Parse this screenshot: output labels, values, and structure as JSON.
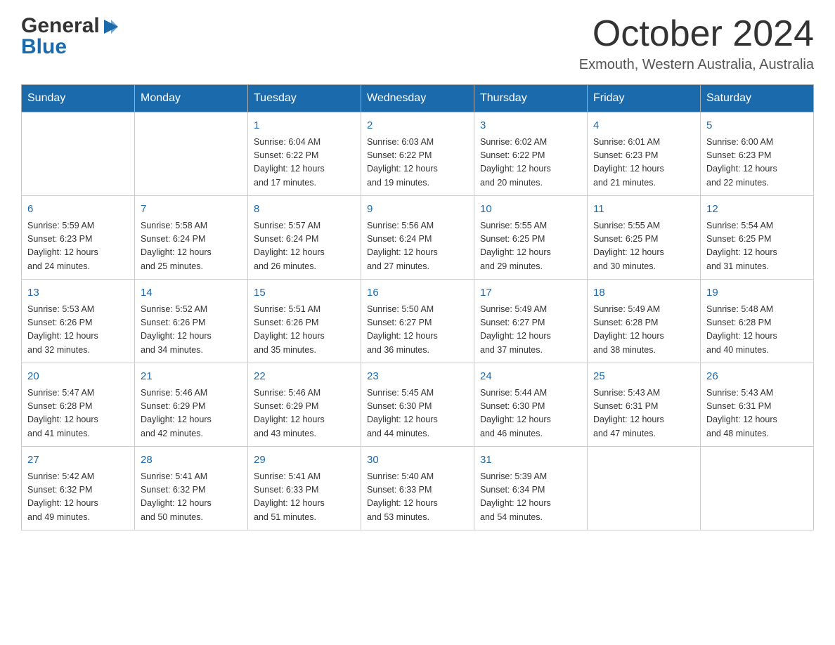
{
  "header": {
    "logo_general": "General",
    "logo_blue": "Blue",
    "month_title": "October 2024",
    "location": "Exmouth, Western Australia, Australia"
  },
  "weekdays": [
    "Sunday",
    "Monday",
    "Tuesday",
    "Wednesday",
    "Thursday",
    "Friday",
    "Saturday"
  ],
  "weeks": [
    [
      {
        "day": "",
        "info": ""
      },
      {
        "day": "",
        "info": ""
      },
      {
        "day": "1",
        "info": "Sunrise: 6:04 AM\nSunset: 6:22 PM\nDaylight: 12 hours\nand 17 minutes."
      },
      {
        "day": "2",
        "info": "Sunrise: 6:03 AM\nSunset: 6:22 PM\nDaylight: 12 hours\nand 19 minutes."
      },
      {
        "day": "3",
        "info": "Sunrise: 6:02 AM\nSunset: 6:22 PM\nDaylight: 12 hours\nand 20 minutes."
      },
      {
        "day": "4",
        "info": "Sunrise: 6:01 AM\nSunset: 6:23 PM\nDaylight: 12 hours\nand 21 minutes."
      },
      {
        "day": "5",
        "info": "Sunrise: 6:00 AM\nSunset: 6:23 PM\nDaylight: 12 hours\nand 22 minutes."
      }
    ],
    [
      {
        "day": "6",
        "info": "Sunrise: 5:59 AM\nSunset: 6:23 PM\nDaylight: 12 hours\nand 24 minutes."
      },
      {
        "day": "7",
        "info": "Sunrise: 5:58 AM\nSunset: 6:24 PM\nDaylight: 12 hours\nand 25 minutes."
      },
      {
        "day": "8",
        "info": "Sunrise: 5:57 AM\nSunset: 6:24 PM\nDaylight: 12 hours\nand 26 minutes."
      },
      {
        "day": "9",
        "info": "Sunrise: 5:56 AM\nSunset: 6:24 PM\nDaylight: 12 hours\nand 27 minutes."
      },
      {
        "day": "10",
        "info": "Sunrise: 5:55 AM\nSunset: 6:25 PM\nDaylight: 12 hours\nand 29 minutes."
      },
      {
        "day": "11",
        "info": "Sunrise: 5:55 AM\nSunset: 6:25 PM\nDaylight: 12 hours\nand 30 minutes."
      },
      {
        "day": "12",
        "info": "Sunrise: 5:54 AM\nSunset: 6:25 PM\nDaylight: 12 hours\nand 31 minutes."
      }
    ],
    [
      {
        "day": "13",
        "info": "Sunrise: 5:53 AM\nSunset: 6:26 PM\nDaylight: 12 hours\nand 32 minutes."
      },
      {
        "day": "14",
        "info": "Sunrise: 5:52 AM\nSunset: 6:26 PM\nDaylight: 12 hours\nand 34 minutes."
      },
      {
        "day": "15",
        "info": "Sunrise: 5:51 AM\nSunset: 6:26 PM\nDaylight: 12 hours\nand 35 minutes."
      },
      {
        "day": "16",
        "info": "Sunrise: 5:50 AM\nSunset: 6:27 PM\nDaylight: 12 hours\nand 36 minutes."
      },
      {
        "day": "17",
        "info": "Sunrise: 5:49 AM\nSunset: 6:27 PM\nDaylight: 12 hours\nand 37 minutes."
      },
      {
        "day": "18",
        "info": "Sunrise: 5:49 AM\nSunset: 6:28 PM\nDaylight: 12 hours\nand 38 minutes."
      },
      {
        "day": "19",
        "info": "Sunrise: 5:48 AM\nSunset: 6:28 PM\nDaylight: 12 hours\nand 40 minutes."
      }
    ],
    [
      {
        "day": "20",
        "info": "Sunrise: 5:47 AM\nSunset: 6:28 PM\nDaylight: 12 hours\nand 41 minutes."
      },
      {
        "day": "21",
        "info": "Sunrise: 5:46 AM\nSunset: 6:29 PM\nDaylight: 12 hours\nand 42 minutes."
      },
      {
        "day": "22",
        "info": "Sunrise: 5:46 AM\nSunset: 6:29 PM\nDaylight: 12 hours\nand 43 minutes."
      },
      {
        "day": "23",
        "info": "Sunrise: 5:45 AM\nSunset: 6:30 PM\nDaylight: 12 hours\nand 44 minutes."
      },
      {
        "day": "24",
        "info": "Sunrise: 5:44 AM\nSunset: 6:30 PM\nDaylight: 12 hours\nand 46 minutes."
      },
      {
        "day": "25",
        "info": "Sunrise: 5:43 AM\nSunset: 6:31 PM\nDaylight: 12 hours\nand 47 minutes."
      },
      {
        "day": "26",
        "info": "Sunrise: 5:43 AM\nSunset: 6:31 PM\nDaylight: 12 hours\nand 48 minutes."
      }
    ],
    [
      {
        "day": "27",
        "info": "Sunrise: 5:42 AM\nSunset: 6:32 PM\nDaylight: 12 hours\nand 49 minutes."
      },
      {
        "day": "28",
        "info": "Sunrise: 5:41 AM\nSunset: 6:32 PM\nDaylight: 12 hours\nand 50 minutes."
      },
      {
        "day": "29",
        "info": "Sunrise: 5:41 AM\nSunset: 6:33 PM\nDaylight: 12 hours\nand 51 minutes."
      },
      {
        "day": "30",
        "info": "Sunrise: 5:40 AM\nSunset: 6:33 PM\nDaylight: 12 hours\nand 53 minutes."
      },
      {
        "day": "31",
        "info": "Sunrise: 5:39 AM\nSunset: 6:34 PM\nDaylight: 12 hours\nand 54 minutes."
      },
      {
        "day": "",
        "info": ""
      },
      {
        "day": "",
        "info": ""
      }
    ]
  ]
}
